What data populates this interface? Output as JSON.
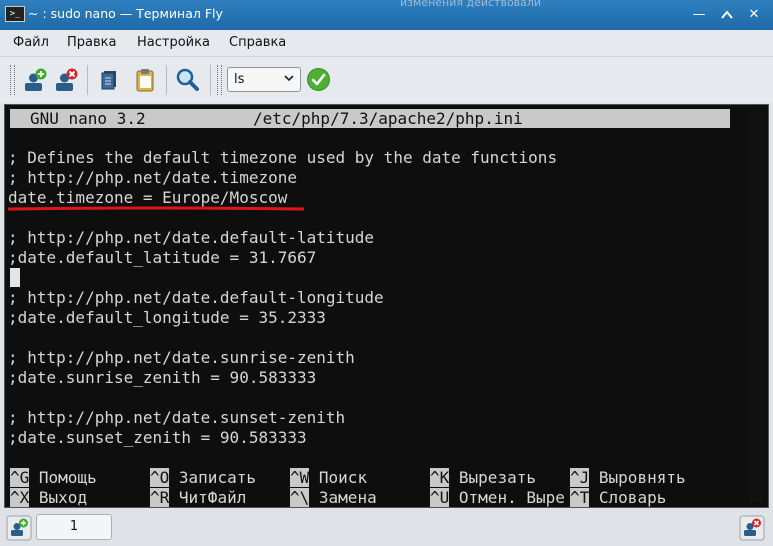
{
  "window": {
    "app_icon": ">_",
    "title": "~ : sudo nano — Терминал Fly",
    "overlay_text": "изменения действовали"
  },
  "menu": [
    "Файл",
    "Правка",
    "Настройка",
    "Справка"
  ],
  "toolbar": {
    "command_value": "ls"
  },
  "nano": {
    "version": "GNU nano 3.2",
    "file": "/etc/php/7.3/apache2/php.ini",
    "lines": [
      "",
      "; Defines the default timezone used by the date functions",
      "; http://php.net/date.timezone",
      "date.timezone = Europe/Moscow",
      "",
      "; http://php.net/date.default-latitude",
      ";date.default_latitude = 31.7667",
      "",
      "; http://php.net/date.default-longitude",
      ";date.default_longitude = 35.2333",
      "",
      "; http://php.net/date.sunrise-zenith",
      ";date.sunrise_zenith = 90.583333",
      "",
      "; http://php.net/date.sunset-zenith",
      ";date.sunset_zenith = 90.583333"
    ],
    "shortcuts_row1": [
      {
        "key": "^G",
        "label": "Помощь"
      },
      {
        "key": "^O",
        "label": "Записать"
      },
      {
        "key": "^W",
        "label": "Поиск"
      },
      {
        "key": "^K",
        "label": "Вырезать"
      },
      {
        "key": "^J",
        "label": "Выровнять"
      }
    ],
    "shortcuts_row2": [
      {
        "key": "^X",
        "label": "Выход"
      },
      {
        "key": "^R",
        "label": "ЧитФайл"
      },
      {
        "key": "^\\",
        "label": "Замена"
      },
      {
        "key": "^U",
        "label": "Отмен. Выре"
      },
      {
        "key": "^T",
        "label": "Словарь"
      }
    ]
  },
  "tabs": [
    {
      "label": "1"
    }
  ],
  "colors": {
    "titlebar": "#1f6aa8",
    "terminal_bg": "#0e0e0e",
    "annotation": "#e0151b",
    "run_green": "#4db035"
  }
}
